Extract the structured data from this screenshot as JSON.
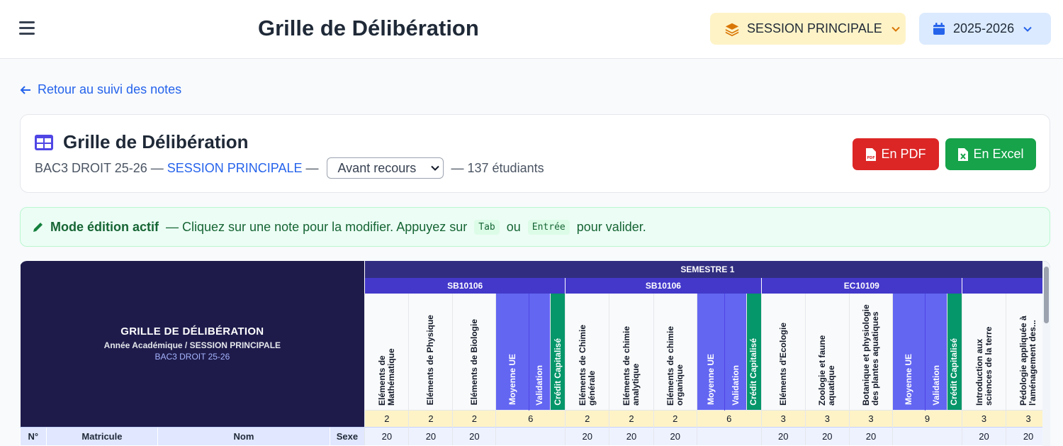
{
  "header": {
    "title": "Grille de Délibération",
    "session_selector": "SESSION PRINCIPALE",
    "year_selector": "2025-2026"
  },
  "back_link": "Retour au suivi des notes",
  "card": {
    "title": "Grille de Délibération",
    "class_name": "BAC3 DROIT 25-26",
    "sep1": " — ",
    "session": "SESSION PRINCIPALE",
    "sep2": " — ",
    "recours": "Avant recours",
    "students": " — 137 étudiants",
    "pdf_label": "En PDF",
    "excel_label": "En Excel"
  },
  "edit_banner": {
    "title": "Mode édition actif",
    "text_before": "— Cliquez sur une note pour la modifier. Appuyez sur",
    "key_tab": "Tab",
    "text_or": "ou",
    "key_enter": "Entrée",
    "text_after": "pour valider."
  },
  "grid": {
    "left_title": "GRILLE DE DÉLIBÉRATION",
    "left_subtitle": "Année Académique / SESSION PRINCIPALE",
    "left_class": "BAC3 DROIT 25-26",
    "semester": "SEMESTRE 1",
    "col_headers": {
      "num": "N°",
      "matricule": "Matricule",
      "nom": "Nom",
      "sexe": "Sexe"
    },
    "ues": [
      {
        "code": "SB10106",
        "courses": [
          {
            "name": "Eléments de Mathématique",
            "credit": "2",
            "max": "20"
          },
          {
            "name": "Eléments de Physique",
            "credit": "2",
            "max": "20"
          },
          {
            "name": "Eléments de Biologie",
            "credit": "2",
            "max": "20"
          }
        ],
        "avg_label": "Moyenne UE",
        "val_label": "Validation",
        "cred_label": "Crédit Capitalisé",
        "total_credit": "6"
      },
      {
        "code": "SB10106",
        "courses": [
          {
            "name": "Eléments de Chimie générale",
            "credit": "2",
            "max": "20"
          },
          {
            "name": "Eléments de chimie analytique",
            "credit": "2",
            "max": "20"
          },
          {
            "name": "Eléments de chimie organique",
            "credit": "2",
            "max": "20"
          }
        ],
        "avg_label": "Moyenne UE",
        "val_label": "Validation",
        "cred_label": "Crédit Capitalisé",
        "total_credit": "6"
      },
      {
        "code": "EC10109",
        "courses": [
          {
            "name": "Eléments d'Ecologie",
            "credit": "3",
            "max": "20"
          },
          {
            "name": "Zoologie et faune aquatique",
            "credit": "3",
            "max": "20"
          },
          {
            "name": "Botanique et physiologie des plantes aquatiques",
            "credit": "3",
            "max": "20"
          }
        ],
        "avg_label": "Moyenne UE",
        "val_label": "Validation",
        "cred_label": "Crédit Capitalisé",
        "total_credit": "9"
      }
    ],
    "extra_courses": [
      {
        "name": "Introduction aux sciences de la terre",
        "credit": "3",
        "max": "20"
      },
      {
        "name": "Pédologie appliquée à l'aménagement des...",
        "credit": "3",
        "max": "20"
      }
    ]
  }
}
